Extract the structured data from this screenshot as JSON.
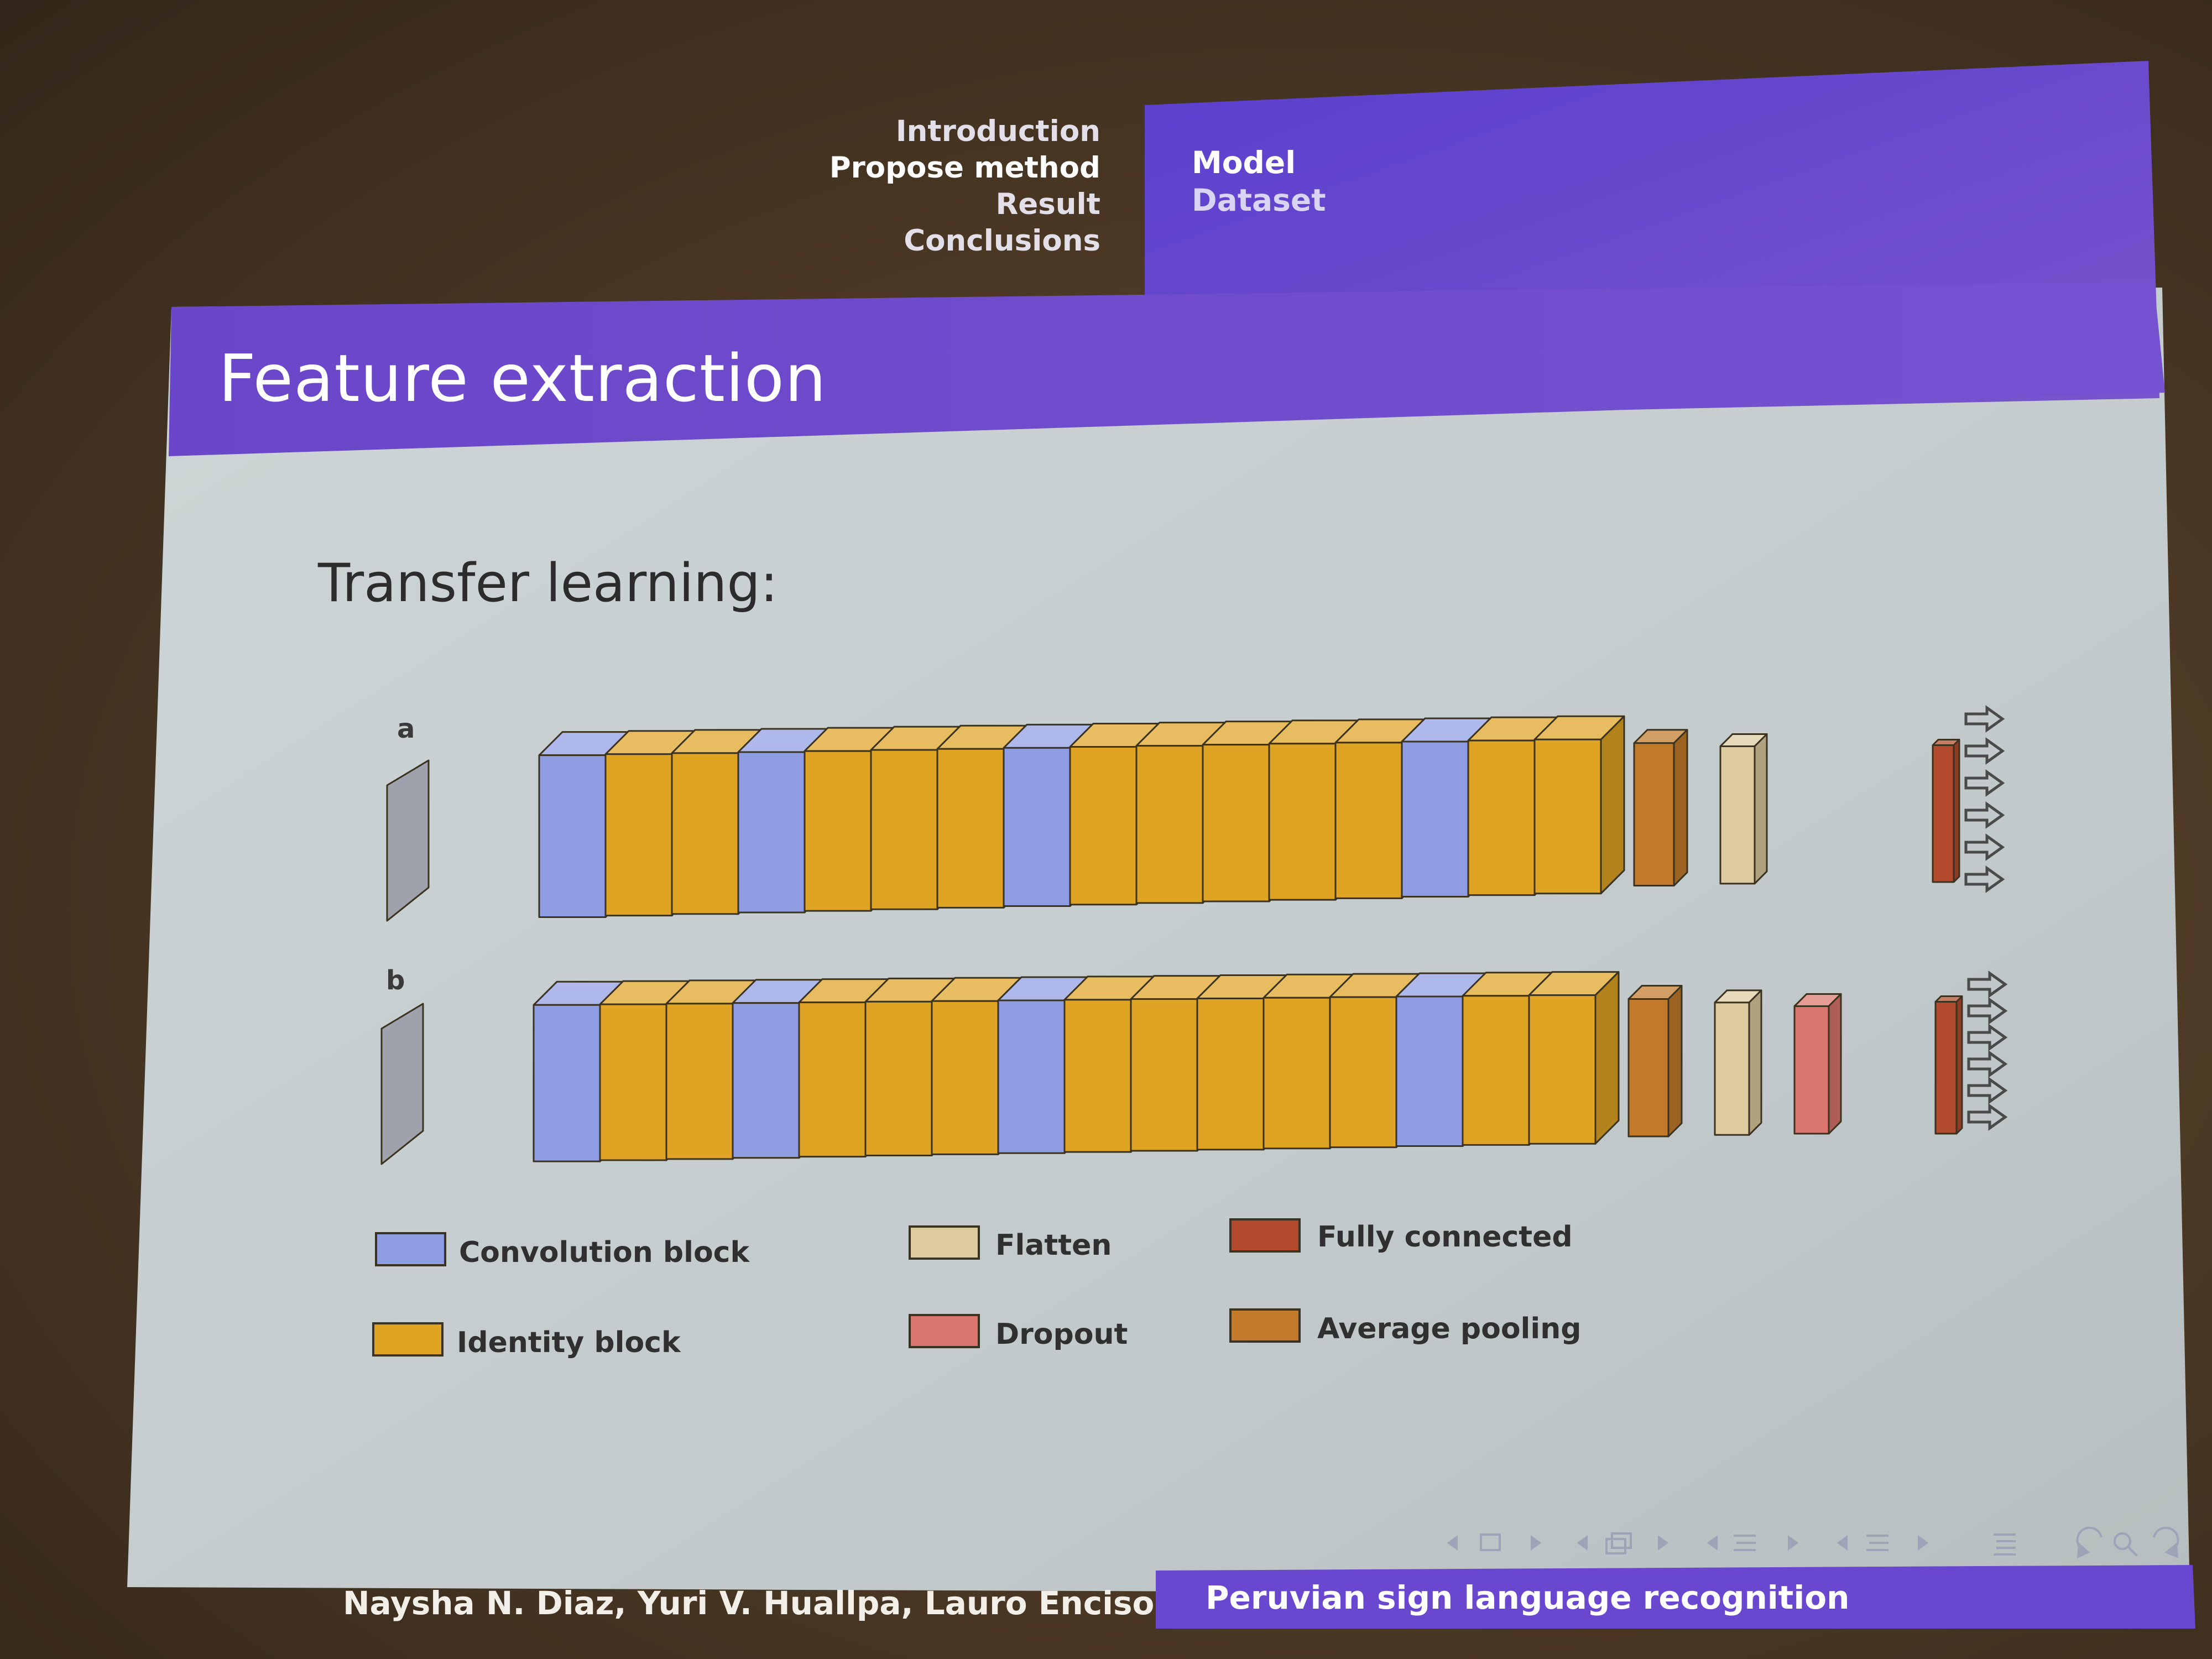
{
  "header": {
    "sections": [
      "Introduction",
      "Propose method",
      "Result",
      "Conclusions"
    ],
    "active_section": "Propose method",
    "subsections": [
      "Model",
      "Dataset"
    ],
    "active_subsection": "Model"
  },
  "frame": {
    "title": "Feature extraction",
    "subtitle": "Transfer learning:"
  },
  "diagram": {
    "rows": [
      {
        "label": "a",
        "layers": [
          "input",
          "conv",
          "id",
          "id",
          "conv",
          "id",
          "id",
          "id",
          "conv",
          "id",
          "id",
          "id",
          "id",
          "id",
          "conv",
          "id",
          "id",
          "avgpool",
          "flatten",
          "fc"
        ]
      },
      {
        "label": "b",
        "layers": [
          "input",
          "conv",
          "id",
          "id",
          "conv",
          "id",
          "id",
          "id",
          "conv",
          "id",
          "id",
          "id",
          "id",
          "id",
          "conv",
          "id",
          "id",
          "avgpool",
          "flatten",
          "dropout",
          "fc"
        ]
      }
    ],
    "legend": [
      {
        "key": "conv",
        "label": "Convolution block"
      },
      {
        "key": "id",
        "label": "Identity block"
      },
      {
        "key": "flatten",
        "label": "Flatten"
      },
      {
        "key": "dropout",
        "label": "Dropout"
      },
      {
        "key": "fc",
        "label": "Fully connected"
      },
      {
        "key": "avgpool",
        "label": "Average pooling"
      }
    ],
    "colors": {
      "conv": "#8e9de2",
      "id": "#dfa424",
      "flatten": "#dccb9f",
      "dropout": "#d9756c",
      "fc": "#b24b2d",
      "avgpool": "#c27a2a",
      "input": "#9fa2ad"
    },
    "output_arrow_count": 6
  },
  "footer": {
    "authors": "Naysha N. Diaz, Yuri V. Huallpa, Lauro Enciso",
    "short_title": "Peruvian sign language recognition"
  },
  "theme": {
    "beamer_purple": "#6a47cf",
    "slide_body": "#c9d1d3"
  }
}
